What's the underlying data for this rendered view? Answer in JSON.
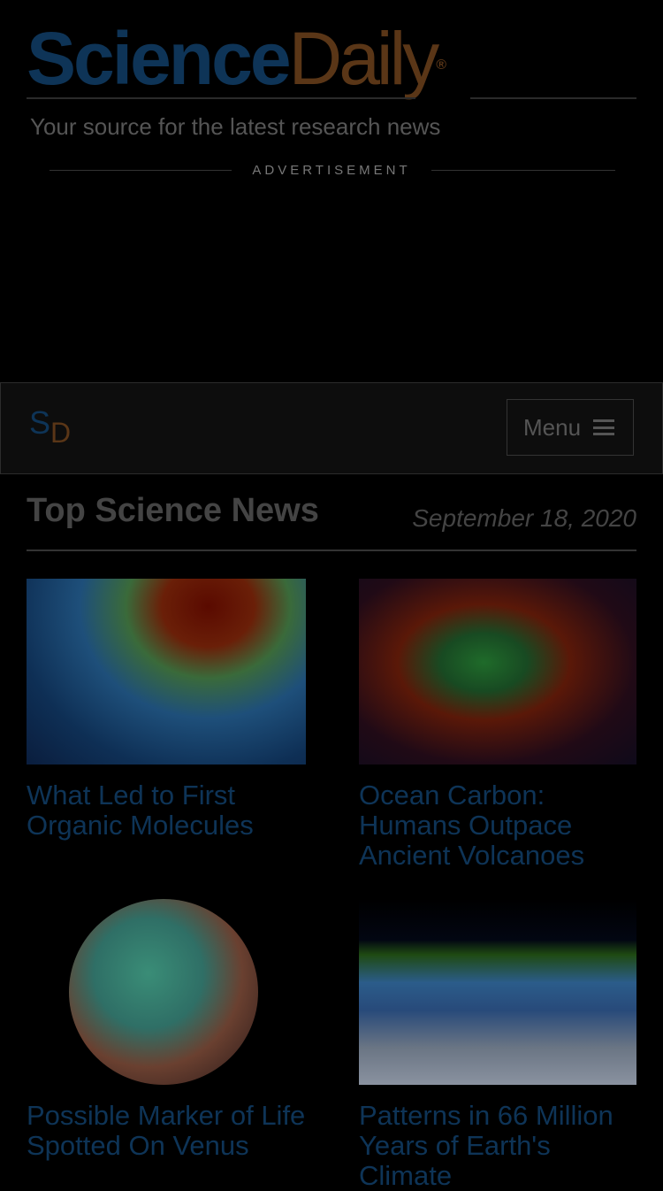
{
  "header": {
    "logo_science": "Science",
    "logo_daily": "Daily",
    "logo_registered": "®",
    "tagline": "Your source for the latest research news",
    "ad_label": "ADVERTISEMENT"
  },
  "navbar": {
    "logo_s": "S",
    "logo_d": "D",
    "menu_label": "Menu"
  },
  "top_news": {
    "title": "Top Science News",
    "date": "September 18, 2020",
    "articles": [
      {
        "title": "What Led to First Organic Molecules"
      },
      {
        "title": "Ocean Carbon: Humans Outpace Ancient Volcanoes"
      },
      {
        "title": "Possible Marker of Life Spotted On Venus"
      },
      {
        "title": "Patterns in 66 Million Years of Earth's Climate"
      }
    ]
  },
  "colors": {
    "science_blue": "#0e3457",
    "daily_brown": "#5a3617"
  }
}
